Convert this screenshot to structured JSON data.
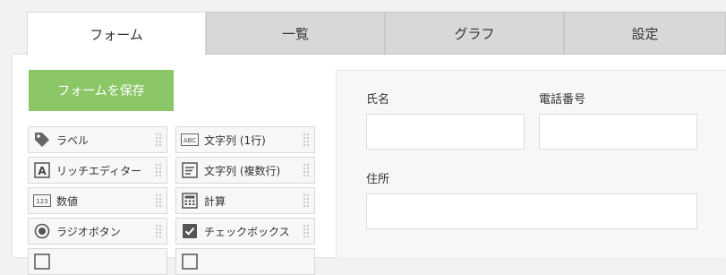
{
  "tabs": [
    {
      "label": "フォーム",
      "active": true
    },
    {
      "label": "一覧",
      "active": false
    },
    {
      "label": "グラフ",
      "active": false
    },
    {
      "label": "設定",
      "active": false
    }
  ],
  "save_button": {
    "label": "フォームを保存",
    "color": "#8bc767"
  },
  "palette": [
    {
      "label": "ラベル",
      "icon": "tag-icon"
    },
    {
      "label": "文字列 (1行)",
      "icon": "abc-text-icon"
    },
    {
      "label": "リッチエディター",
      "icon": "rich-editor-icon"
    },
    {
      "label": "文字列 (複数行)",
      "icon": "multiline-text-icon"
    },
    {
      "label": "数値",
      "icon": "number-123-icon"
    },
    {
      "label": "計算",
      "icon": "calculator-icon"
    },
    {
      "label": "ラジオボタン",
      "icon": "radio-button-icon"
    },
    {
      "label": "チェックボックス",
      "icon": "checkbox-icon"
    }
  ],
  "form_fields": [
    {
      "label": "氏名"
    },
    {
      "label": "電話番号"
    },
    {
      "label": "住所"
    }
  ]
}
